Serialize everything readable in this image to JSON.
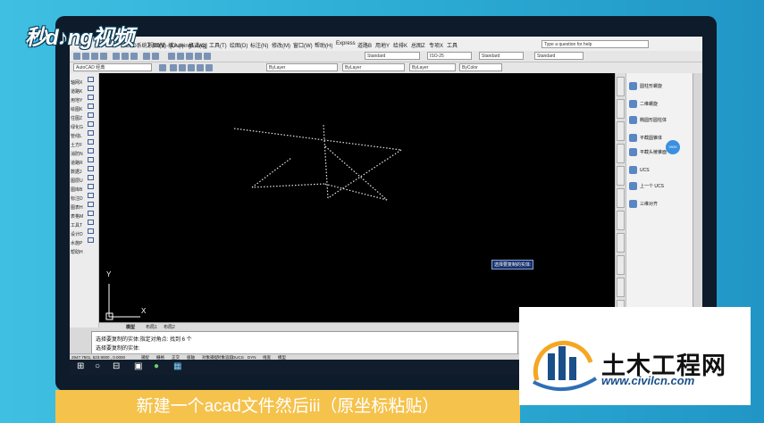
{
  "logo": {
    "text": "秒d♪ng视频"
  },
  "titlebar": {
    "title": "CAD系统】6.0版 - [Drawing1.dwg]",
    "help_placeholder": "Type a question for help"
  },
  "menu": [
    "文件(F)",
    "视图(V)",
    "插入(I)",
    "格式(O)",
    "工具(T)",
    "绘图(D)",
    "标注(N)",
    "修改(M)",
    "窗口(W)",
    "帮助(H)",
    "Express",
    "道路B",
    "用地Y",
    "给排K",
    "总图Z",
    "专项X",
    "工具"
  ],
  "toolbar": {
    "workspace": "AutoCAD 经典",
    "text_style": "Standard",
    "dim_style": "ISO-25",
    "table_style": "Standard",
    "mleader_style": "Standard",
    "layer_combo": "ByLayer",
    "linetype_combo": "ByLayer",
    "lineweight_combo": "ByLayer",
    "color_combo": "ByColor"
  },
  "left_panel": [
    "轴网X",
    "道路K",
    "用地Y",
    "绘图K",
    "住图Z",
    "绿化G",
    "管线L",
    "土方F",
    "消防N",
    "道路R",
    "数据J",
    "图层U",
    "图库B",
    "标注D",
    "图表H",
    "表格M",
    "工具T",
    "设计D",
    "水施P",
    "帮助H"
  ],
  "canvas": {
    "tooltip": "选择要复制的实体:",
    "ucs_x": "X",
    "ucs_y": "Y"
  },
  "layout_tabs": [
    "模型",
    "布局1",
    "布局2"
  ],
  "command_lines": [
    "选择要复制的实体:指定对角点: 找到 6 个",
    "选择要复制的实体:"
  ],
  "status": {
    "coords": "2947.7501, 523.9000 , 0.0000",
    "buttons": [
      "捕捉",
      "栅格",
      "正交",
      "极轴",
      "对象捕捉",
      "对象追踪",
      "DUCS",
      "DYN",
      "线宽",
      "模型"
    ]
  },
  "right_panel": {
    "items": [
      "圆柱形螺旋",
      "二维螺旋",
      "椭圆形圆柱体",
      "平截圆锥体",
      "平截头棱锥面",
      "UCS",
      "上一个 UCS",
      "三维对齐"
    ],
    "badge": "0929"
  },
  "caption": "新建一个acad文件然后iii（原坐标粘贴）",
  "watermark": {
    "name": "土木工程网",
    "url": "www.civilcn.com"
  },
  "colors": {
    "accent": "#2fb1d6",
    "caption_bg": "#f5c24c",
    "canvas": "#000000"
  }
}
